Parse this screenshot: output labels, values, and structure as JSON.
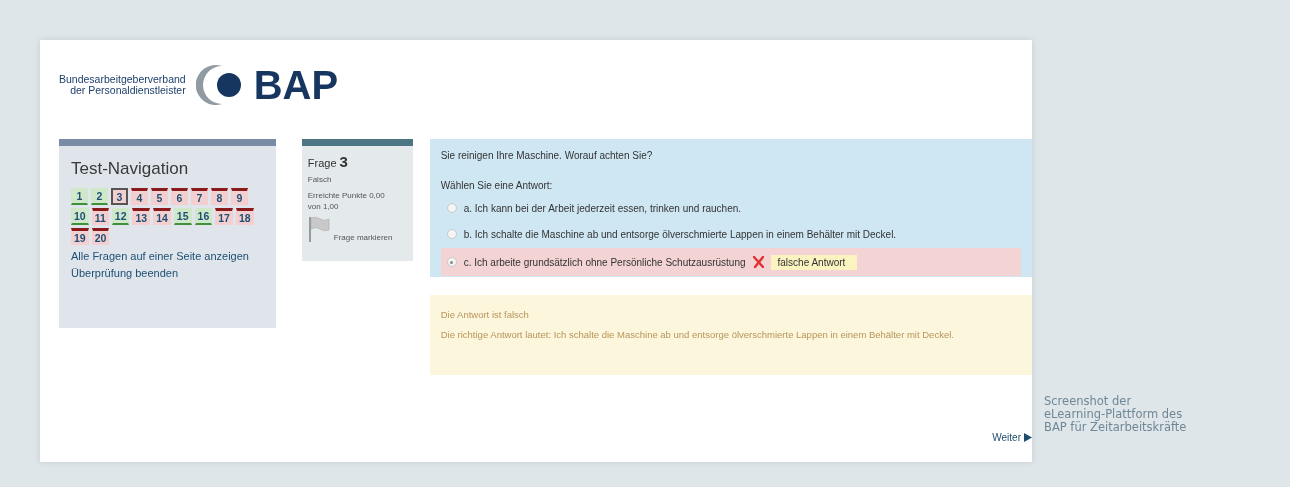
{
  "logo": {
    "org_line1": "Bundesarbeitgeberverband",
    "org_line2": "der Personaldienstleister",
    "brand": "BAP"
  },
  "navigation": {
    "title": "Test-Navigation",
    "questions": [
      {
        "label": "1",
        "correct": true,
        "selected": false
      },
      {
        "label": "2",
        "correct": true,
        "selected": false
      },
      {
        "label": "3",
        "correct": false,
        "selected": true
      },
      {
        "label": "4",
        "correct": false,
        "selected": false
      },
      {
        "label": "5",
        "correct": false,
        "selected": false
      },
      {
        "label": "6",
        "correct": false,
        "selected": false
      },
      {
        "label": "7",
        "correct": false,
        "selected": false
      },
      {
        "label": "8",
        "correct": false,
        "selected": false
      },
      {
        "label": "9",
        "correct": false,
        "selected": false
      },
      {
        "label": "10",
        "correct": true,
        "selected": false
      },
      {
        "label": "11",
        "correct": false,
        "selected": false
      },
      {
        "label": "12",
        "correct": true,
        "selected": false
      },
      {
        "label": "13",
        "correct": false,
        "selected": false
      },
      {
        "label": "14",
        "correct": false,
        "selected": false
      },
      {
        "label": "15",
        "correct": true,
        "selected": false
      },
      {
        "label": "16",
        "correct": true,
        "selected": false
      },
      {
        "label": "17",
        "correct": false,
        "selected": false
      },
      {
        "label": "18",
        "correct": false,
        "selected": false
      },
      {
        "label": "19",
        "correct": false,
        "selected": false
      },
      {
        "label": "20",
        "correct": false,
        "selected": false
      }
    ],
    "links": [
      "Alle Fragen auf einer Seite anzeigen",
      "Überprüfung beenden"
    ]
  },
  "question_info": {
    "label": "Frage",
    "number": "3",
    "status": "Falsch",
    "points": "Erreichte Punkte 0,00 von 1,00",
    "flag_label": "Frage markieren"
  },
  "question": {
    "text": "Sie reinigen Ihre Maschine. Worauf achten Sie?",
    "prompt": "Wählen Sie eine Antwort:",
    "answers": [
      {
        "text": "a. Ich kann bei der Arbeit jederzeit essen, trinken und rauchen.",
        "selected": false
      },
      {
        "text": "b. Ich schalte die Maschine ab und entsorge ölverschmierte Lappen in einem Behälter mit Deckel.",
        "selected": false
      },
      {
        "text": "c. Ich arbeite grundsätzlich ohne Persönliche Schutzausrüstung",
        "selected": true,
        "correct": false,
        "result_label": "falsche Antwort"
      }
    ]
  },
  "feedback": {
    "verdict": "Die Antwort ist falsch",
    "correct_answer": "Die richtige Antwort lautet: Ich schalte die Maschine ab und entsorge ölverschmierte Lappen in einem Behälter mit Deckel."
  },
  "next_button": "Weiter",
  "caption": [
    "Screenshot der",
    "eLearning-Plattform des",
    "BAP für Zeitarbeitskräfte"
  ]
}
